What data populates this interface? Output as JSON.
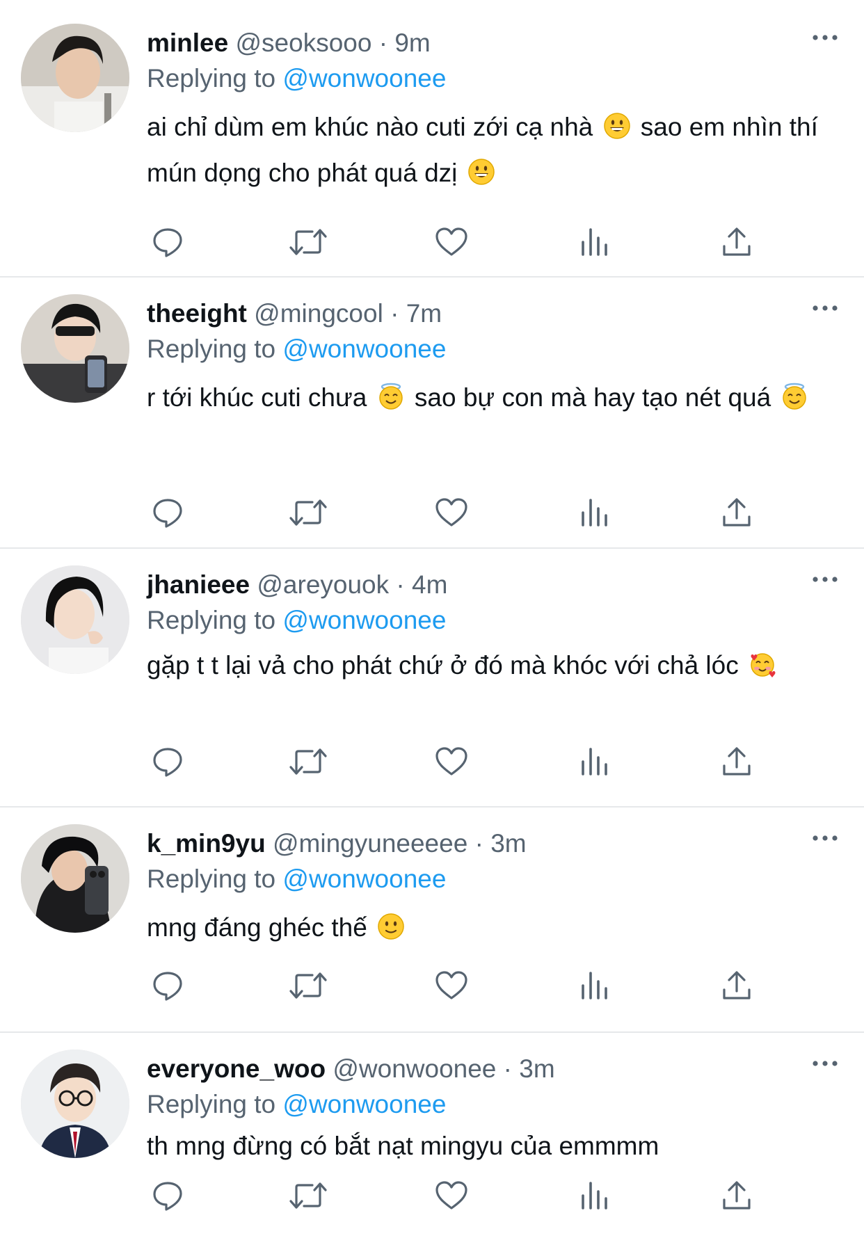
{
  "tweets": [
    {
      "name": "minlee",
      "handle": "@seoksooo",
      "dot": "·",
      "time": "9m",
      "replying_prefix": "Replying to",
      "replying_handle": "@wonwoonee",
      "text_parts": [
        "ai chỉ dùm em khúc nào cuti zới cạ nhà ",
        " sao em nhìn thí mún dọng cho phát quá dzị "
      ],
      "emojis": [
        "grinning-face-emoji",
        "grinning-face-emoji"
      ]
    },
    {
      "name": "theeight",
      "handle": "@mingcool",
      "dot": "·",
      "time": "7m",
      "replying_prefix": "Replying to",
      "replying_handle": "@wonwoonee",
      "text_parts": [
        "r tới khúc cuti chưa ",
        " sao bự con mà hay tạo nét quá "
      ],
      "emojis": [
        "halo-face-emoji",
        "halo-face-emoji"
      ]
    },
    {
      "name": "jhanieee",
      "handle": "@areyouok",
      "dot": "·",
      "time": "4m",
      "replying_prefix": "Replying to",
      "replying_handle": "@wonwoonee",
      "text_parts": [
        "gặp t t lại vả cho phát chứ ở đó mà khóc với chả lóc "
      ],
      "emojis": [
        "smiling-hearts-emoji"
      ]
    },
    {
      "name": "k_min9yu",
      "handle": "@mingyuneeeee",
      "dot": "·",
      "time": "3m",
      "replying_prefix": "Replying to",
      "replying_handle": "@wonwoonee",
      "text_parts": [
        "mng đáng ghéc thế "
      ],
      "emojis": [
        "slight-smile-emoji"
      ]
    },
    {
      "name": "everyone_woo",
      "handle": "@wonwoonee",
      "dot": "·",
      "time": "3m",
      "replying_prefix": "Replying to",
      "replying_handle": "@wonwoonee",
      "text_parts": [
        "th mng đừng có bắt nạt mingyu của emmmm"
      ],
      "emojis": []
    }
  ],
  "colors": {
    "link": "#1d9bf0",
    "secondary": "#566370",
    "divider": "#e6e8ea",
    "icon": "#566370"
  },
  "icons": [
    "reply-icon",
    "retweet-icon",
    "like-icon",
    "views-icon",
    "share-icon",
    "more-icon"
  ]
}
